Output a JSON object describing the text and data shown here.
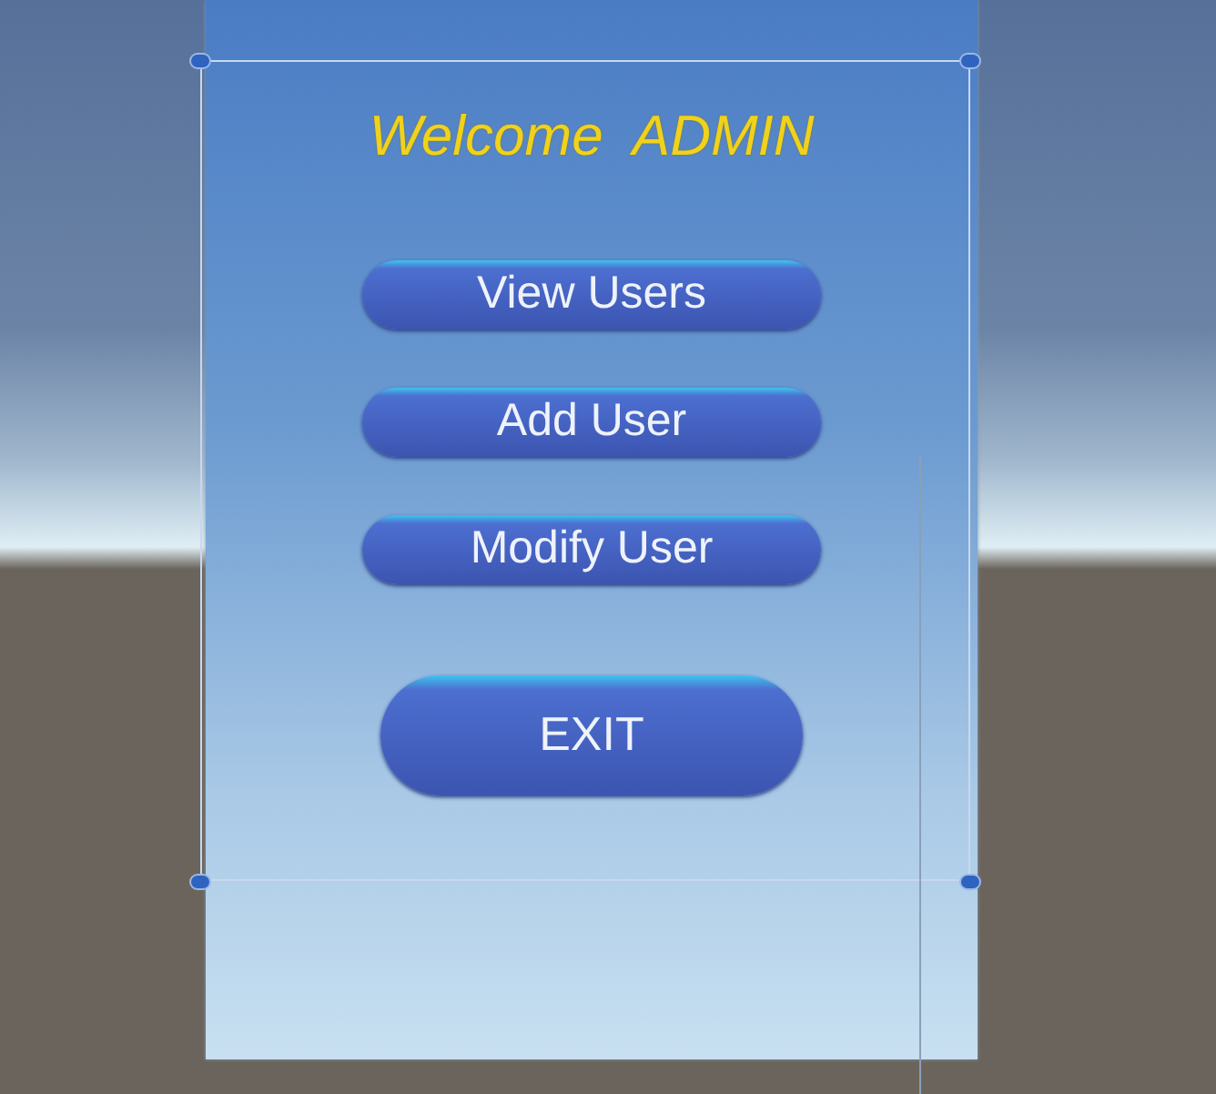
{
  "panel": {
    "title": "Welcome  ADMIN"
  },
  "buttons": [
    {
      "label": "View Users",
      "kind": "menu"
    },
    {
      "label": "Add User",
      "kind": "menu"
    },
    {
      "label": "Modify User",
      "kind": "menu"
    },
    {
      "label": "EXIT",
      "kind": "exit"
    }
  ]
}
